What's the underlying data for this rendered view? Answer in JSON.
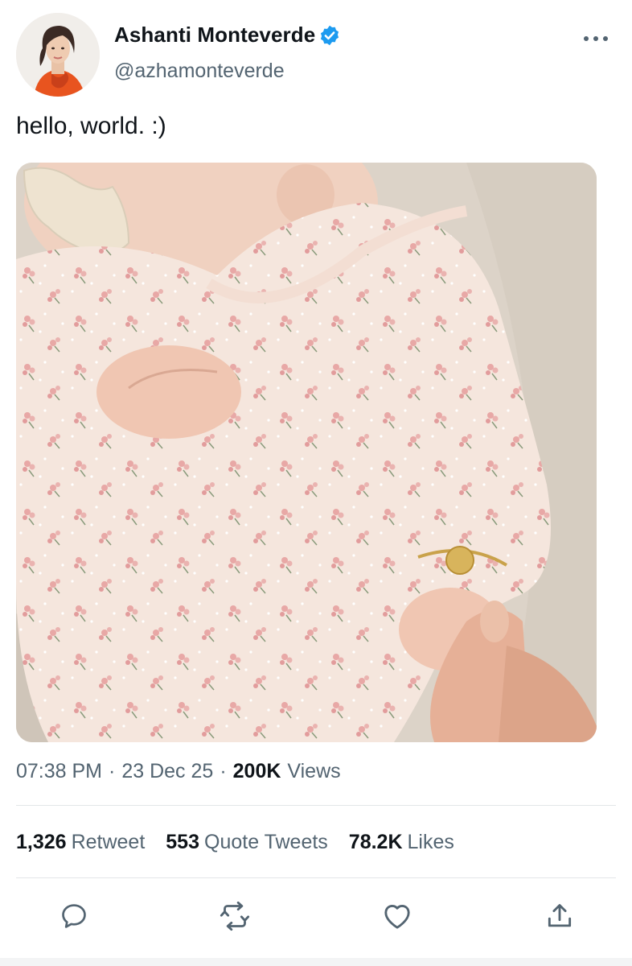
{
  "author": {
    "display_name": "Ashanti Monteverde",
    "handle": "@azhamonteverde",
    "verified": true,
    "avatar": "profile-photo"
  },
  "tweet": {
    "text": "hello, world. :)",
    "media": "photo-baby-floral-onesie"
  },
  "meta": {
    "time": "07:38 PM",
    "date": "23 Dec 25",
    "views_count": "200K",
    "views_label": "Views"
  },
  "stats": {
    "retweets_count": "1,326",
    "retweets_label": "Retweet",
    "quotes_count": "553",
    "quotes_label": "Quote Tweets",
    "likes_count": "78.2K",
    "likes_label": "Likes"
  },
  "icons": {
    "more": "more-horizontal-icon",
    "reply": "reply-icon",
    "retweet": "retweet-icon",
    "like": "heart-icon",
    "share": "share-icon"
  },
  "colors": {
    "text": "#0f1419",
    "secondary": "#536471",
    "verified": "#1d9bf0",
    "divider": "#e3e6e8"
  }
}
